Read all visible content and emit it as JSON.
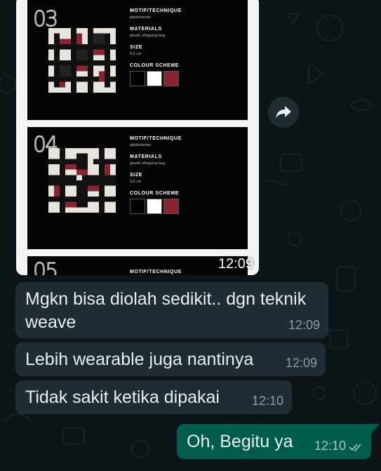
{
  "image_message": {
    "time": "12:09",
    "slides": [
      {
        "number": "03",
        "motif_label": "MOTIF/TECHNIQUE",
        "motif_value": "plaids/tartan",
        "materials_label": "MATERIALS",
        "materials_value": "plastic shopping bag",
        "size_label": "SIZE",
        "size_value": "0,5 cm",
        "colour_label": "COLOUR SCHEME"
      },
      {
        "number": "04",
        "motif_label": "MOTIF/TECHNIQUE",
        "motif_value": "plaids/tartan",
        "materials_label": "MATERIALS",
        "materials_value": "plastic shopping bag",
        "size_label": "SIZE",
        "size_value": "0,5 cm",
        "colour_label": "COLOUR SCHEME"
      },
      {
        "number": "05",
        "motif_label": "MOTIF/TECHNIQUE"
      }
    ],
    "colour_scheme": [
      "#000000",
      "#ffffff",
      "#8a2430"
    ]
  },
  "forward_icon": "forward-arrow-icon",
  "messages": [
    {
      "text": "Mgkn bisa diolah sedikit.. dgn teknik weave",
      "time": "12:09"
    },
    {
      "text": "Lebih wearable juga nantinya",
      "time": "12:09"
    },
    {
      "text": "Tidak sakit ketika dipakai",
      "time": "12:10"
    }
  ],
  "outgoing": {
    "text": "Oh, Begitu ya",
    "time": "12:10",
    "status_icon": "double-check-icon"
  },
  "colors": {
    "background": "#0d1418",
    "incoming_bubble": "#1f2c34",
    "outgoing_bubble": "#005c4b",
    "text": "#e9edef"
  }
}
